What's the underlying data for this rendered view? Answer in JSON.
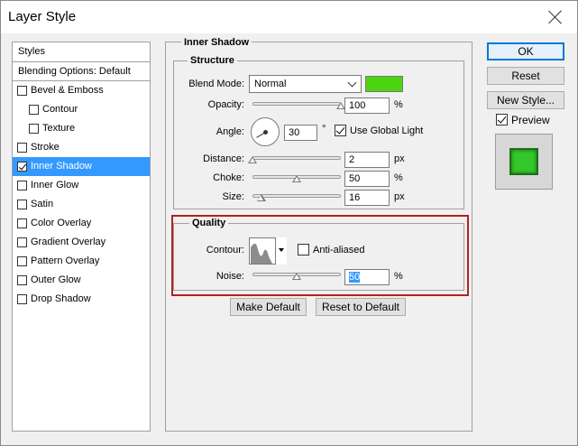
{
  "window": {
    "title": "Layer Style"
  },
  "styles_panel": {
    "header": "Styles",
    "blending": "Blending Options: Default",
    "items": [
      {
        "label": "Bevel & Emboss",
        "checked": false,
        "indent": false,
        "selected": false
      },
      {
        "label": "Contour",
        "checked": false,
        "indent": true,
        "selected": false
      },
      {
        "label": "Texture",
        "checked": false,
        "indent": true,
        "selected": false
      },
      {
        "label": "Stroke",
        "checked": false,
        "indent": false,
        "selected": false
      },
      {
        "label": "Inner Shadow",
        "checked": true,
        "indent": false,
        "selected": true
      },
      {
        "label": "Inner Glow",
        "checked": false,
        "indent": false,
        "selected": false
      },
      {
        "label": "Satin",
        "checked": false,
        "indent": false,
        "selected": false
      },
      {
        "label": "Color Overlay",
        "checked": false,
        "indent": false,
        "selected": false
      },
      {
        "label": "Gradient Overlay",
        "checked": false,
        "indent": false,
        "selected": false
      },
      {
        "label": "Pattern Overlay",
        "checked": false,
        "indent": false,
        "selected": false
      },
      {
        "label": "Outer Glow",
        "checked": false,
        "indent": false,
        "selected": false
      },
      {
        "label": "Drop Shadow",
        "checked": false,
        "indent": false,
        "selected": false
      }
    ]
  },
  "inner_shadow": {
    "title": "Inner Shadow",
    "structure": {
      "title": "Structure",
      "blend_mode_label": "Blend Mode:",
      "blend_mode_value": "Normal",
      "shadow_color": "#4cd411",
      "opacity_label": "Opacity:",
      "opacity_value": "100",
      "opacity_unit": "%",
      "opacity_level": 1.0,
      "angle_label": "Angle:",
      "angle_value": "30",
      "angle_unit": "°",
      "use_global_light_label": "Use Global Light",
      "use_global_light": true,
      "distance_label": "Distance:",
      "distance_value": "2",
      "distance_unit": "px",
      "distance_level": 0.0,
      "choke_label": "Choke:",
      "choke_value": "50",
      "choke_unit": "%",
      "choke_level": 0.5,
      "size_label": "Size:",
      "size_value": "16",
      "size_unit": "px",
      "size_level": 0.1
    },
    "quality": {
      "title": "Quality",
      "contour_label": "Contour:",
      "anti_aliased_label": "Anti-aliased",
      "anti_aliased": false,
      "noise_label": "Noise:",
      "noise_value": "50",
      "noise_unit": "%",
      "noise_level": 0.5
    },
    "make_default_label": "Make Default",
    "reset_to_default_label": "Reset to Default"
  },
  "right_panel": {
    "ok_label": "OK",
    "reset_label": "Reset",
    "new_style_label": "New Style...",
    "preview_label": "Preview",
    "preview_checked": true
  },
  "colors": {
    "selection": "#3399ff",
    "highlight_border": "#b22222",
    "preview_fill": "#35c82a"
  }
}
